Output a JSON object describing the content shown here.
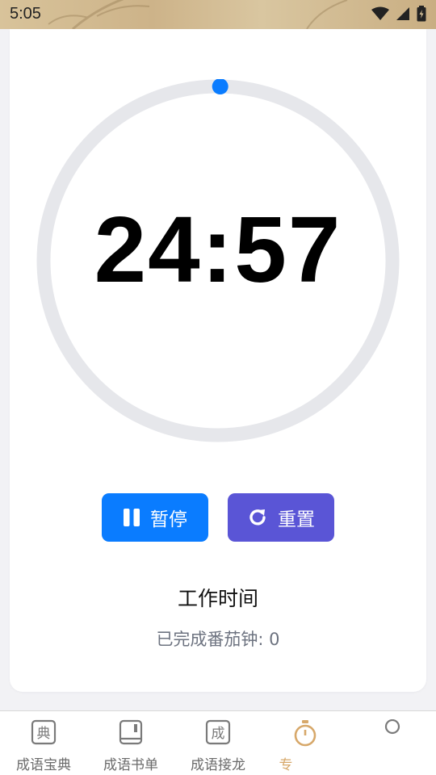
{
  "status_bar": {
    "time": "5:05"
  },
  "timer": {
    "display": "24:57",
    "progress_fraction": 0.002,
    "ring_color": "#e6e7eb",
    "knob_color": "#0a7cff"
  },
  "controls": {
    "pause_label": "暂停",
    "reset_label": "重置"
  },
  "session": {
    "mode_label": "工作时间",
    "completed_text": "已完成番茄钟: 0"
  },
  "tabbar": {
    "items": [
      {
        "label": "成语宝典",
        "icon": "dictionary-icon",
        "glyph": "典"
      },
      {
        "label": "成语书单",
        "icon": "book-icon",
        "glyph": ""
      },
      {
        "label": "成语接龙",
        "icon": "chain-icon",
        "glyph": "成"
      },
      {
        "label": "专",
        "icon": "timer-icon",
        "glyph": "",
        "active": true
      },
      {
        "label": "",
        "icon": "profile-icon",
        "glyph": ""
      }
    ],
    "active_color": "#d7a86a"
  }
}
